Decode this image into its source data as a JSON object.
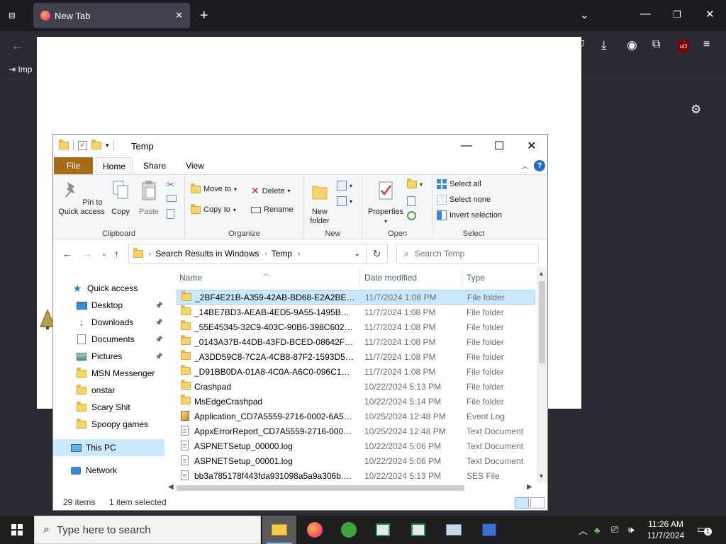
{
  "browser": {
    "tab_title": "New Tab",
    "bookmark_label": "Imp",
    "ublock_label": "uO"
  },
  "explorer": {
    "title": "Temp",
    "ribbon_tabs": {
      "file": "File",
      "home": "Home",
      "share": "Share",
      "view": "View"
    },
    "groups": {
      "clipboard": {
        "label": "Clipboard",
        "pin_label": "Pin to Quick access",
        "copy_label": "Copy",
        "paste_label": "Paste"
      },
      "organize": {
        "label": "Organize",
        "move_to": "Move to",
        "copy_to": "Copy to",
        "delete": "Delete",
        "rename": "Rename"
      },
      "new": {
        "label": "New",
        "new_folder": "New folder"
      },
      "open": {
        "label": "Open",
        "properties": "Properties"
      },
      "select": {
        "label": "Select",
        "select_all": "Select all",
        "select_none": "Select none",
        "invert": "Invert selection"
      }
    },
    "address": {
      "crumb1": "Search Results in Windows",
      "crumb2": "Temp"
    },
    "search_placeholder": "Search Temp",
    "nav": {
      "quick_access": "Quick access",
      "items": [
        {
          "label": "Desktop",
          "icon": "desktop-icon",
          "pinned": true
        },
        {
          "label": "Downloads",
          "icon": "download-arrow-icon",
          "pinned": true
        },
        {
          "label": "Documents",
          "icon": "documents-icon",
          "pinned": true
        },
        {
          "label": "Pictures",
          "icon": "pictures-icon",
          "pinned": true
        },
        {
          "label": "MSN Messenger",
          "icon": "folder-icon",
          "pinned": false
        },
        {
          "label": "onstar",
          "icon": "folder-icon",
          "pinned": false
        },
        {
          "label": "Scary Shit",
          "icon": "folder-icon",
          "pinned": false
        },
        {
          "label": "Spoopy games",
          "icon": "folder-icon",
          "pinned": false
        }
      ],
      "this_pc": "This PC",
      "network": "Network"
    },
    "columns": {
      "name": "Name",
      "date": "Date modified",
      "type": "Type"
    },
    "files": [
      {
        "name": "_2BF4E21B-A359-42AB-BD68-E2A2BED3C...",
        "date": "11/7/2024 1:08 PM",
        "type": "File folder",
        "icon": "folder",
        "selected": true
      },
      {
        "name": "_14BE7BD3-AEAB-4ED5-9A55-1495BF434...",
        "date": "11/7/2024 1:08 PM",
        "type": "File folder",
        "icon": "folder"
      },
      {
        "name": "_55E45345-32C9-403C-90B6-398C6026743B",
        "date": "11/7/2024 1:08 PM",
        "type": "File folder",
        "icon": "folder"
      },
      {
        "name": "_0143A37B-44DB-43FD-BCED-08642F559...",
        "date": "11/7/2024 1:08 PM",
        "type": "File folder",
        "icon": "folder"
      },
      {
        "name": "_A3DD59C8-7C2A-4CB8-87F2-1593D5ED...",
        "date": "11/7/2024 1:08 PM",
        "type": "File folder",
        "icon": "folder"
      },
      {
        "name": "_D91BB0DA-01A8-4C0A-A6C0-096C1966...",
        "date": "11/7/2024 1:08 PM",
        "type": "File folder",
        "icon": "folder"
      },
      {
        "name": "Crashpad",
        "date": "10/22/2024 5:13 PM",
        "type": "File folder",
        "icon": "folder"
      },
      {
        "name": "MsEdgeCrashpad",
        "date": "10/22/2024 5:14 PM",
        "type": "File folder",
        "icon": "folder"
      },
      {
        "name": "Application_CD7A5559-2716-0002-6A5C-...",
        "date": "10/25/2024 12:48 PM",
        "type": "Event Log",
        "icon": "log"
      },
      {
        "name": "AppxErrorReport_CD7A5559-2716-0002-6...",
        "date": "10/25/2024 12:48 PM",
        "type": "Text Document",
        "icon": "doc"
      },
      {
        "name": "ASPNETSetup_00000.log",
        "date": "10/22/2024 5:06 PM",
        "type": "Text Document",
        "icon": "doc"
      },
      {
        "name": "ASPNETSetup_00001.log",
        "date": "10/22/2024 5:06 PM",
        "type": "Text Document",
        "icon": "doc"
      },
      {
        "name": "bb3a785178f443fda931098a5a9a306b.db.s...",
        "date": "10/22/2024 5:13 PM",
        "type": "SES File",
        "icon": "doc"
      }
    ],
    "status": {
      "count": "29 items",
      "selected": "1 item selected"
    }
  },
  "taskbar": {
    "search_placeholder": "Type here to search",
    "time": "11:26 AM",
    "date": "11/7/2024",
    "notification_count": "1"
  }
}
